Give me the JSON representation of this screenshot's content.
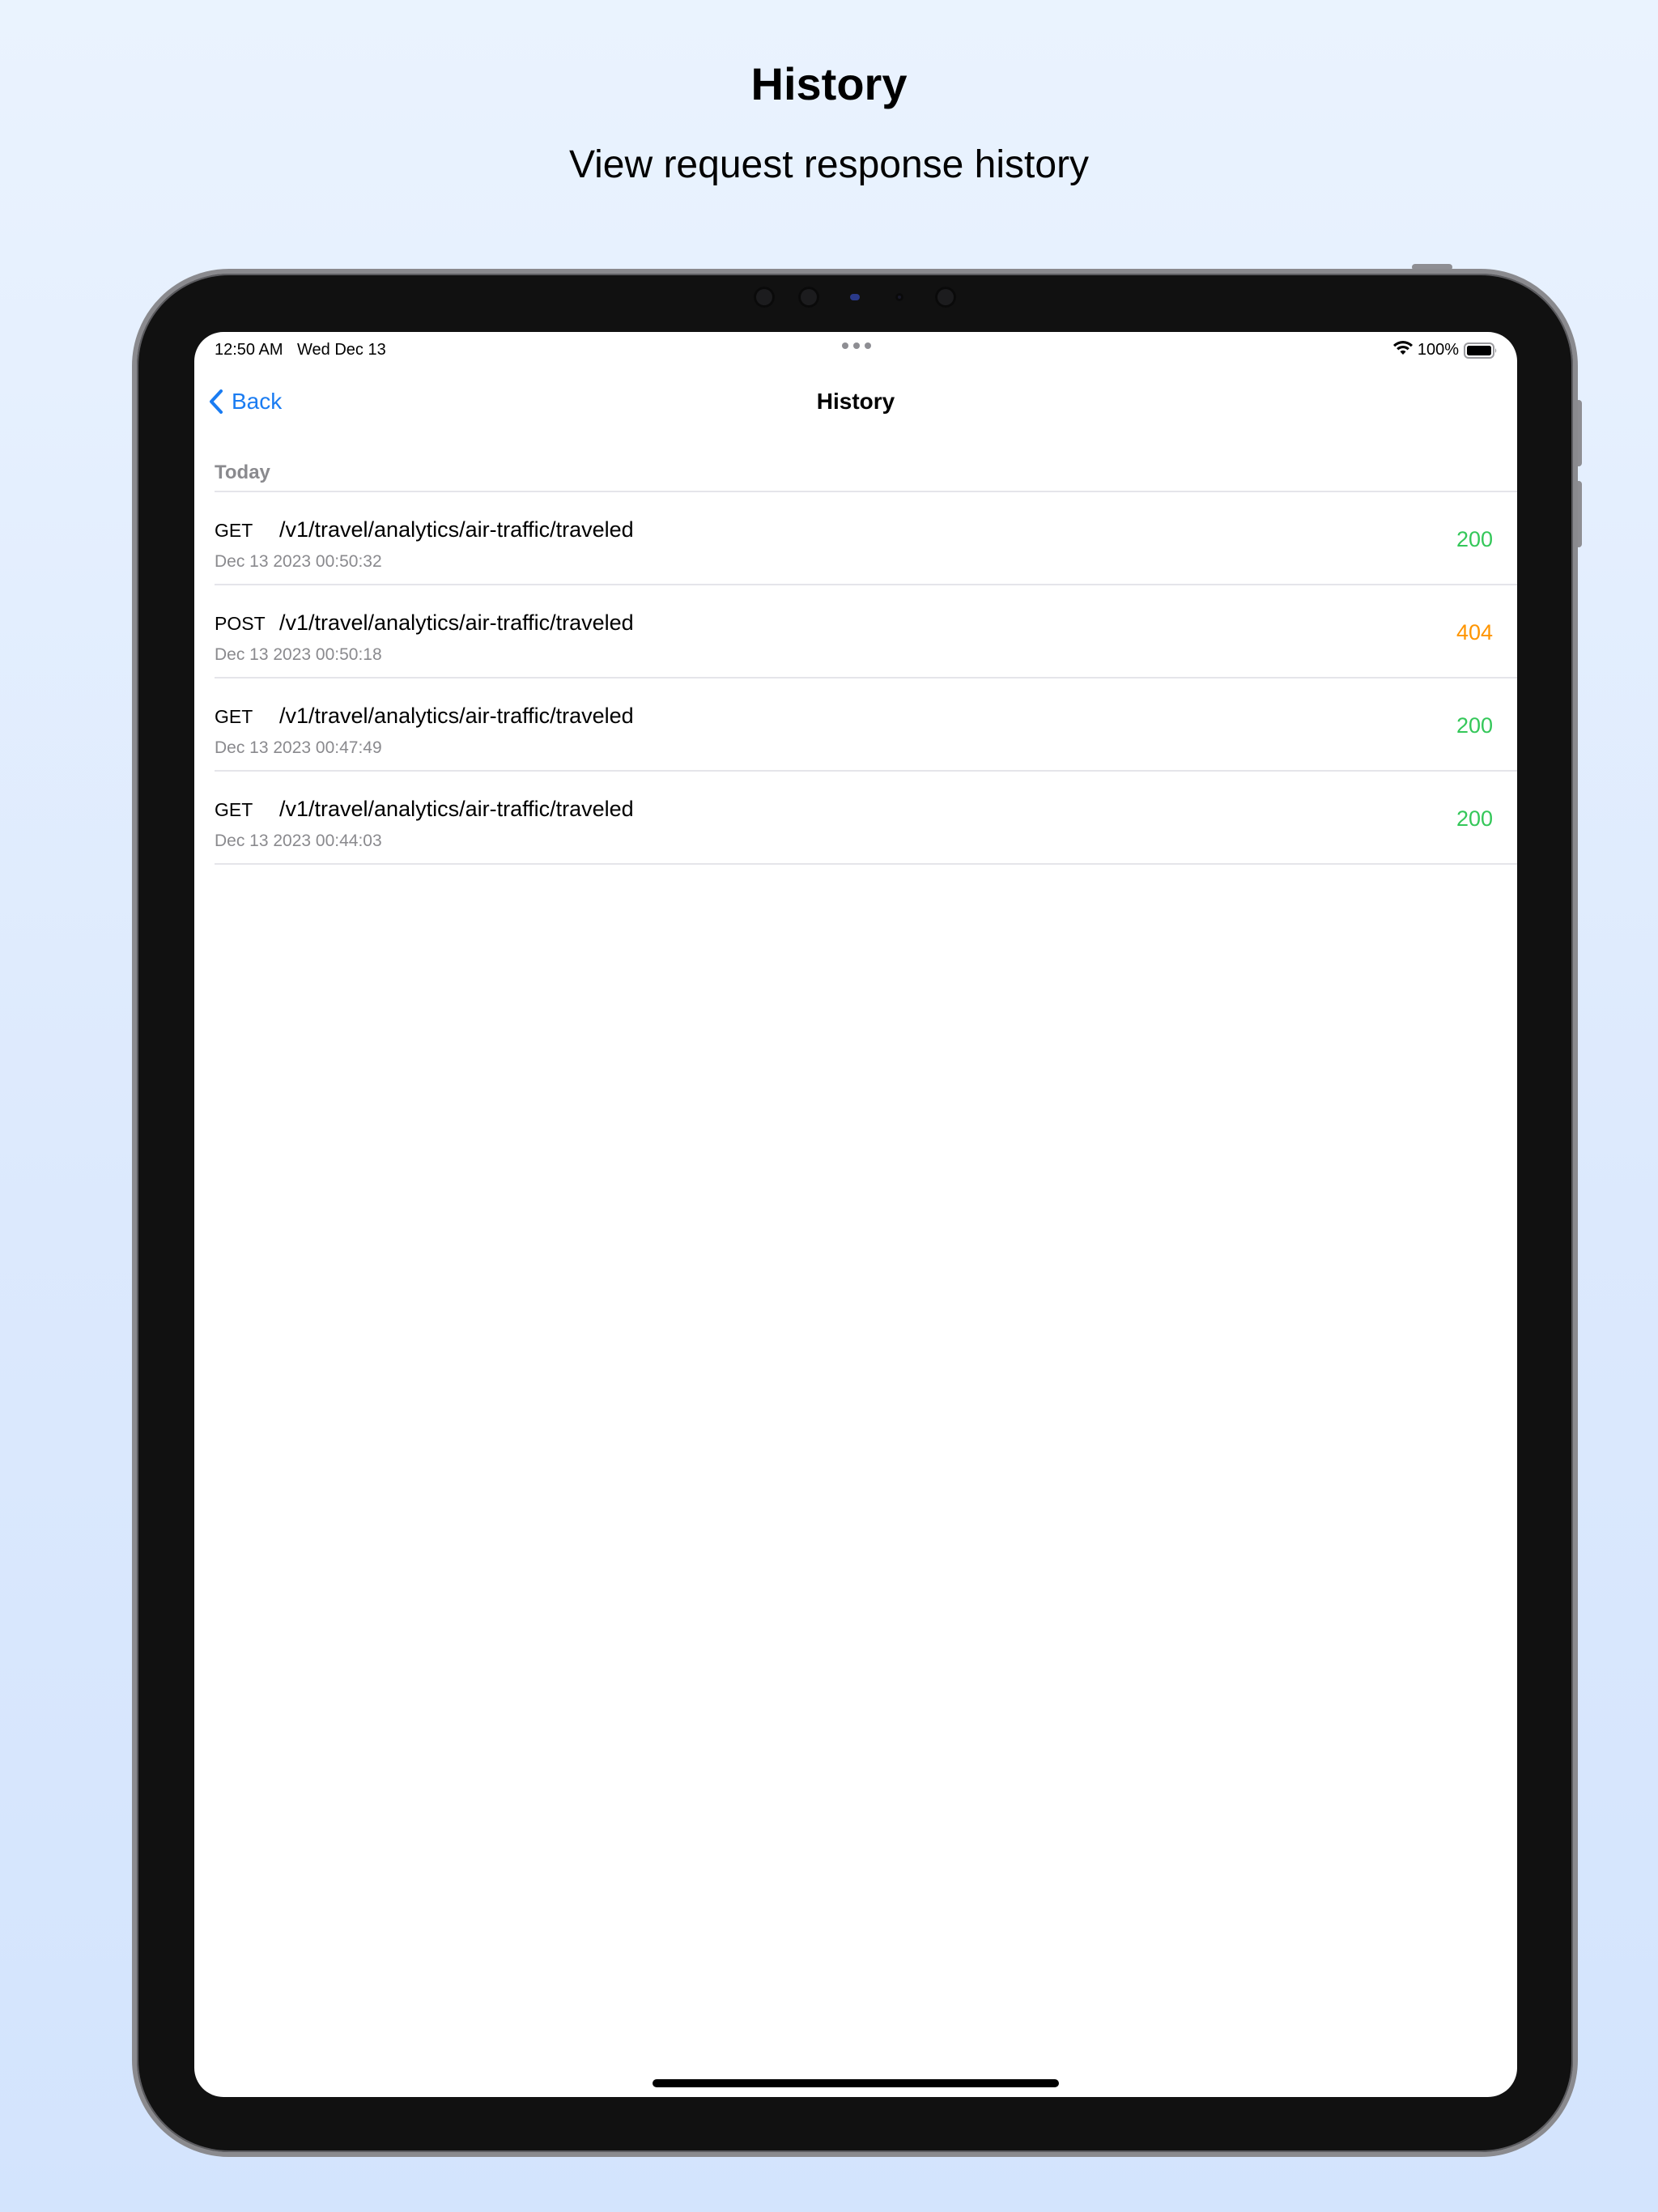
{
  "promo": {
    "title": "History",
    "subtitle": "View request response history"
  },
  "status_bar": {
    "time": "12:50 AM",
    "date": "Wed Dec 13",
    "battery": "100%"
  },
  "nav": {
    "back_label": "Back",
    "title": "History"
  },
  "section": {
    "header": "Today"
  },
  "colors": {
    "accent": "#1a7cf2",
    "status_ok": "#34c759",
    "status_error": "#ff9500"
  },
  "requests": [
    {
      "method": "GET",
      "path": "/v1/travel/analytics/air-traffic/traveled",
      "timestamp": "Dec 13 2023 00:50:32",
      "status": "200",
      "status_color": "#34c759"
    },
    {
      "method": "POST",
      "path": "/v1/travel/analytics/air-traffic/traveled",
      "timestamp": "Dec 13 2023 00:50:18",
      "status": "404",
      "status_color": "#ff9500"
    },
    {
      "method": "GET",
      "path": "/v1/travel/analytics/air-traffic/traveled",
      "timestamp": "Dec 13 2023 00:47:49",
      "status": "200",
      "status_color": "#34c759"
    },
    {
      "method": "GET",
      "path": "/v1/travel/analytics/air-traffic/traveled",
      "timestamp": "Dec 13 2023 00:44:03",
      "status": "200",
      "status_color": "#34c759"
    }
  ]
}
